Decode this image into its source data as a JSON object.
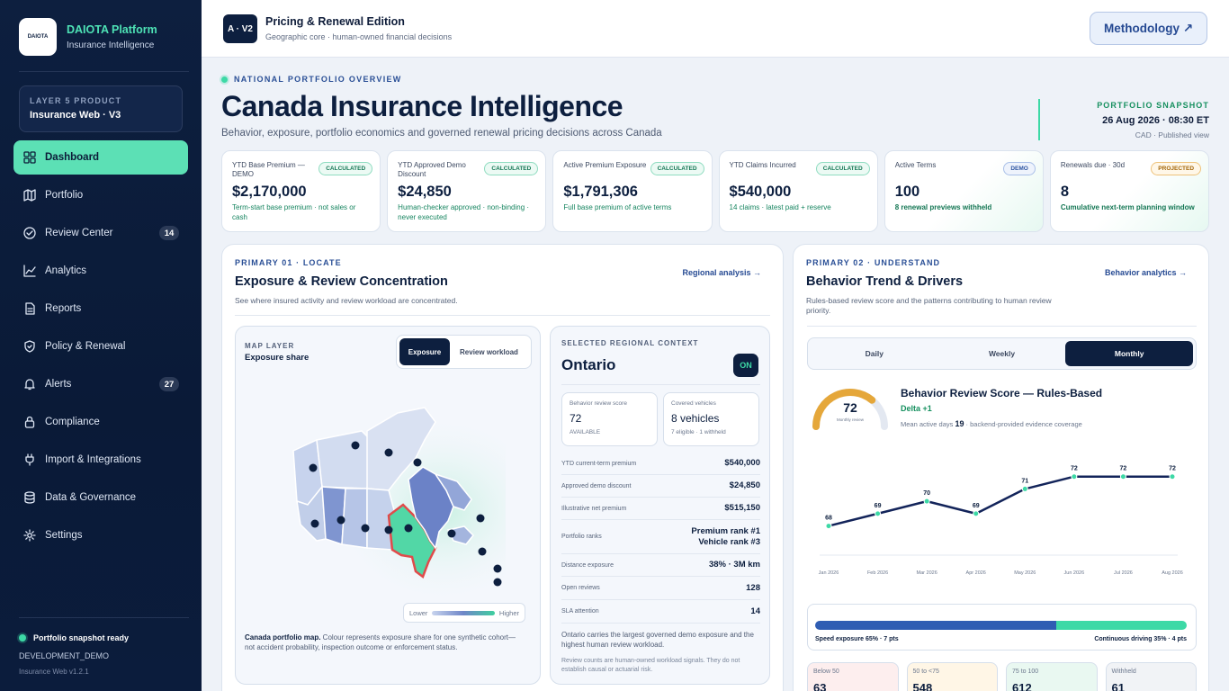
{
  "sidebar": {
    "brand": {
      "logo": "DAIOTA",
      "title": "DAIOTA Platform",
      "subtitle": "Insurance Intelligence"
    },
    "product": {
      "label": "LAYER 5 PRODUCT",
      "value": "Insurance Web · V3"
    },
    "items": [
      {
        "label": "Dashboard",
        "icon": "grid-icon",
        "active": true
      },
      {
        "label": "Portfolio",
        "icon": "map-icon"
      },
      {
        "label": "Review Center",
        "icon": "check-circle-icon",
        "badge": "14"
      },
      {
        "label": "Analytics",
        "icon": "chart-line-icon"
      },
      {
        "label": "Reports",
        "icon": "document-icon"
      },
      {
        "label": "Policy & Renewal",
        "icon": "shield-icon"
      },
      {
        "label": "Alerts",
        "icon": "bell-icon",
        "badge": "27"
      },
      {
        "label": "Compliance",
        "icon": "lock-icon"
      },
      {
        "label": "Import & Integrations",
        "icon": "plug-icon"
      },
      {
        "label": "Data & Governance",
        "icon": "database-icon"
      },
      {
        "label": "Settings",
        "icon": "gear-icon"
      }
    ],
    "footer": {
      "status": "Portfolio snapshot ready",
      "env": "DEVELOPMENT_DEMO",
      "version": "Insurance Web v1.2.1"
    }
  },
  "topbar": {
    "version": "A · V2",
    "title": "Pricing & Renewal Edition",
    "subtitle": "Geographic core · human-owned financial decisions",
    "methodology": "Methodology ↗"
  },
  "hero": {
    "kicker": "NATIONAL PORTFOLIO OVERVIEW",
    "title": "Canada Insurance Intelligence",
    "subtitle": "Behavior, exposure, portfolio economics and governed renewal pricing decisions across Canada"
  },
  "snapshot": {
    "label": "PORTFOLIO SNAPSHOT",
    "date": "26 Aug 2026 · 08:30 ET",
    "note": "CAD · Published view"
  },
  "kpis": [
    {
      "label": "YTD Base Premium — DEMO",
      "tag": "CALCULATED",
      "value": "$2,170,000",
      "note": "Term-start base premium · not sales or cash"
    },
    {
      "label": "YTD Approved Demo Discount",
      "tag": "CALCULATED",
      "value": "$24,850",
      "note": "Human-checker approved · non-binding · never executed"
    },
    {
      "label": "Active Premium Exposure",
      "tag": "CALCULATED",
      "value": "$1,791,306",
      "note": "Full base premium of active terms"
    },
    {
      "label": "YTD Claims Incurred",
      "tag": "CALCULATED",
      "value": "$540,000",
      "note": "14 claims · latest paid + reserve"
    },
    {
      "label": "Active Terms",
      "tag": "DEMO",
      "value": "100",
      "note": "8 renewal previews withheld"
    },
    {
      "label": "Renewals due · 30d",
      "tag": "PROJECTED",
      "value": "8",
      "note": "Cumulative next-term planning window"
    }
  ],
  "panel1": {
    "kicker": "PRIMARY 01 · LOCATE",
    "title": "Exposure & Review Concentration",
    "subtitle": "See where insured activity and review workload are concentrated.",
    "link": "Regional analysis →",
    "map": {
      "layer_label": "MAP LAYER",
      "layer_value": "Exposure share",
      "seg_on": "Exposure",
      "seg_off": "Review workload",
      "legend_low": "Lower",
      "legend_high": "Higher",
      "caption_bold": "Canada portfolio map.",
      "caption": " Colour represents exposure share for one synthetic cohort—not accident probability, inspection outcome or enforcement status."
    },
    "context": {
      "label": "SELECTED REGIONAL CONTEXT",
      "region": "Ontario",
      "toggle": "ON",
      "card1": {
        "label": "Behavior review score",
        "value": "72",
        "sub": "AVAILABLE"
      },
      "card2": {
        "label": "Covered vehicles",
        "value": "8 vehicles",
        "sub": "7 eligible · 1 withheld"
      },
      "rows": [
        {
          "k": "YTD current-term premium",
          "v": "$540,000"
        },
        {
          "k": "Approved demo discount",
          "v": "$24,850"
        },
        {
          "k": "Illustrative net premium",
          "v": "$515,150"
        },
        {
          "k": "Portfolio ranks",
          "v": "Premium rank #1",
          "v2": "Vehicle rank #3"
        },
        {
          "k": "Distance exposure",
          "v": "38% · 3M km"
        },
        {
          "k": "Open reviews",
          "v": "128"
        },
        {
          "k": "SLA attention",
          "v": "14"
        }
      ],
      "note": "Ontario carries the largest governed demo exposure and the highest human review workload.",
      "note2": "Review counts are human-owned workload signals. They do not establish causal or actuarial risk."
    }
  },
  "panel2": {
    "kicker": "PRIMARY 02 · UNDERSTAND",
    "title": "Behavior Trend & Drivers",
    "subtitle": "Rules-based review score and the patterns contributing to human review priority.",
    "link": "Behavior analytics →",
    "tabs": [
      "Daily",
      "Weekly",
      "Monthly"
    ],
    "score": {
      "value": "72",
      "caption": "Monthly review",
      "fraction": 0.72,
      "title": "Behavior Review Score — Rules-Based",
      "delta": "Delta +1",
      "meta_pre": "Mean active days ",
      "meta_num": "19",
      "meta_post": " · backend-provided evidence coverage"
    },
    "mix": {
      "left": "Speed exposure 65% · 7 pts",
      "right": "Continuous driving 35% · 4 pts",
      "left_pct": 65,
      "right_pct": 35
    },
    "bands": [
      {
        "label": "Below 50",
        "value": "63",
        "color": "#fdeeee"
      },
      {
        "label": "50 to <75",
        "value": "548",
        "color": "#fff6e6"
      },
      {
        "label": "75 to 100",
        "value": "612",
        "color": "#e9f8f1"
      },
      {
        "label": "Withheld",
        "value": "61",
        "color": "#f1f3f6"
      }
    ]
  },
  "chart_data": {
    "type": "line",
    "categories": [
      "Jan 2026",
      "Feb 2026",
      "Mar 2026",
      "Apr 2026",
      "May 2026",
      "Jun 2026",
      "Jul 2026",
      "Aug 2026"
    ],
    "values": [
      68,
      69,
      70,
      69,
      71,
      72,
      72,
      72
    ],
    "title": "",
    "xlabel": "",
    "ylabel": "",
    "ylim": [
      66,
      73
    ],
    "grid": false,
    "line_color": "#13245a",
    "point_color": "#3dd9a6"
  },
  "colors": {
    "navy": "#0d1f3f",
    "accent": "#3dd9a6",
    "blue": "#2f5db3",
    "danger": "#e04b4b"
  }
}
